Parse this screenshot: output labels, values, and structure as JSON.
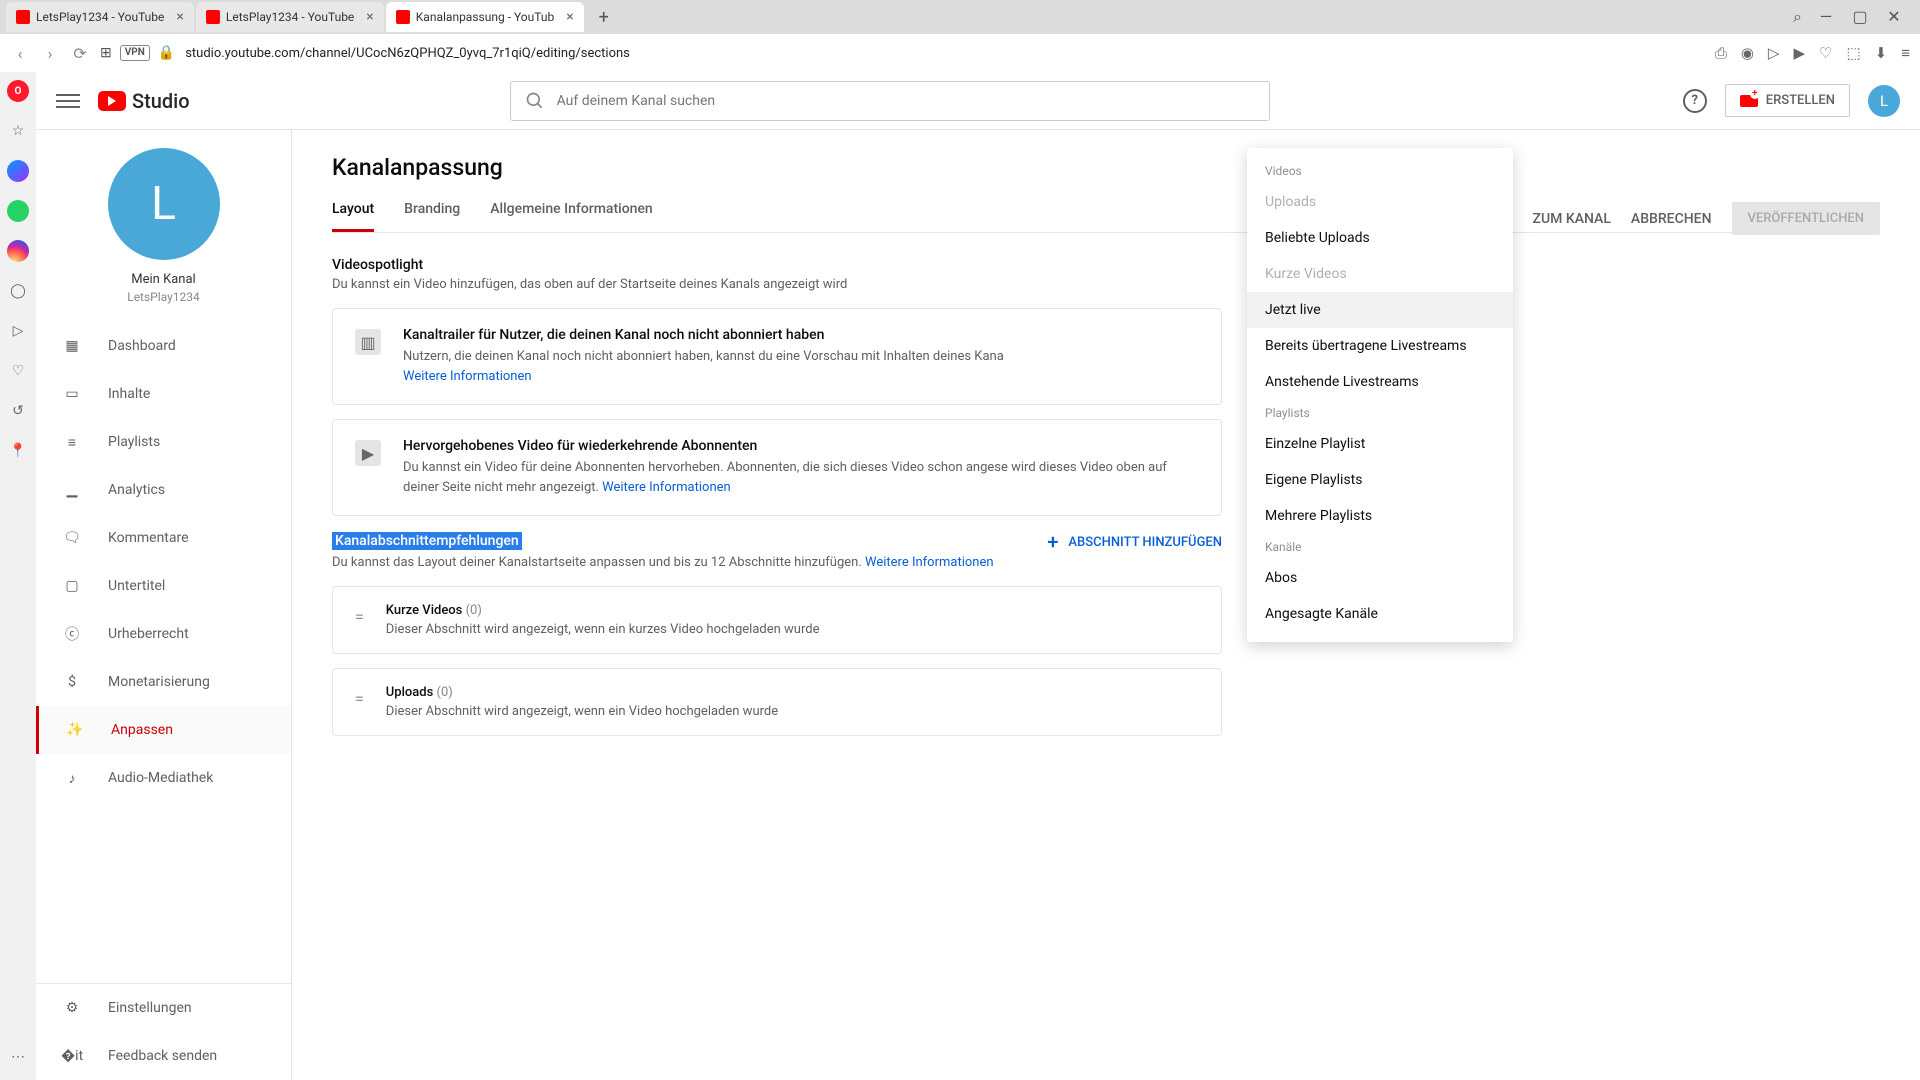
{
  "browser": {
    "tabs": [
      {
        "title": "LetsPlay1234 - YouTube"
      },
      {
        "title": "LetsPlay1234 - YouTube"
      },
      {
        "title": "Kanalanpassung - YouTub"
      }
    ],
    "url": "studio.youtube.com/channel/UCocN6zQPHQZ_0yvq_7r1qiQ/editing/sections",
    "vpn": "VPN",
    "search_icon": "🔍"
  },
  "header": {
    "logo_text": "Studio",
    "search_placeholder": "Auf deinem Kanal suchen",
    "help": "?",
    "create": "ERSTELLEN",
    "avatar_letter": "L"
  },
  "channel": {
    "avatar_letter": "L",
    "name": "Mein Kanal",
    "handle": "LetsPlay1234"
  },
  "nav": {
    "dashboard": "Dashboard",
    "content": "Inhalte",
    "playlists": "Playlists",
    "analytics": "Analytics",
    "comments": "Kommentare",
    "subtitles": "Untertitel",
    "copyright": "Urheberrecht",
    "monetization": "Monetarisierung",
    "customization": "Anpassen",
    "audio": "Audio-Mediathek",
    "settings": "Einstellungen",
    "feedback": "Feedback senden"
  },
  "page": {
    "title": "Kanalanpassung",
    "tabs": {
      "layout": "Layout",
      "branding": "Branding",
      "basic": "Allgemeine Informationen"
    },
    "actions": {
      "view": "ZUM KANAL",
      "cancel": "ABBRECHEN",
      "publish": "VERÖFFENTLICHEN"
    },
    "spotlight": {
      "title": "Videospotlight",
      "desc": "Du kannst ein Video hinzufügen, das oben auf der Startseite deines Kanals angezeigt wird",
      "trailer_title": "Kanaltrailer für Nutzer, die deinen Kanal noch nicht abonniert haben",
      "trailer_desc": "Nutzern, die deinen Kanal noch nicht abonniert haben, kannst du eine Vorschau mit Inhalten deines Kana",
      "more": "Weitere Informationen",
      "featured_title": "Hervorgehobenes Video für wiederkehrende Abonnenten",
      "featured_desc": "Du kannst ein Video für deine Abonnenten hervorheben. Abonnenten, die sich dieses Video schon angese wird dieses Video oben auf deiner Seite nicht mehr angezeigt. "
    },
    "sections": {
      "title": "Kanalabschnittempfehlungen",
      "desc_pre": "Du kannst das Layout deiner Kanalstartseite anpassen und bis zu 12 Abschnitte hinzufügen. ",
      "more": "Weitere Informationen",
      "add_btn": "ABSCHNITT HINZUFÜGEN",
      "rows": [
        {
          "name": "Kurze Videos",
          "count": "(0)",
          "desc": "Dieser Abschnitt wird angezeigt, wenn ein kurzes Video hochgeladen wurde"
        },
        {
          "name": "Uploads",
          "count": "(0)",
          "desc": "Dieser Abschnitt wird angezeigt, wenn ein Video hochgeladen wurde"
        }
      ]
    }
  },
  "dropdown": {
    "videos_header": "Videos",
    "uploads": "Uploads",
    "popular": "Beliebte Uploads",
    "shorts": "Kurze Videos",
    "live_now": "Jetzt live",
    "past_live": "Bereits übertragene Livestreams",
    "upcoming_live": "Anstehende Livestreams",
    "playlists_header": "Playlists",
    "single_playlist": "Einzelne Playlist",
    "own_playlists": "Eigene Playlists",
    "multiple_playlists": "Mehrere Playlists",
    "channels_header": "Kanäle",
    "subs": "Abos",
    "featured_channels": "Angesagte Kanäle"
  }
}
